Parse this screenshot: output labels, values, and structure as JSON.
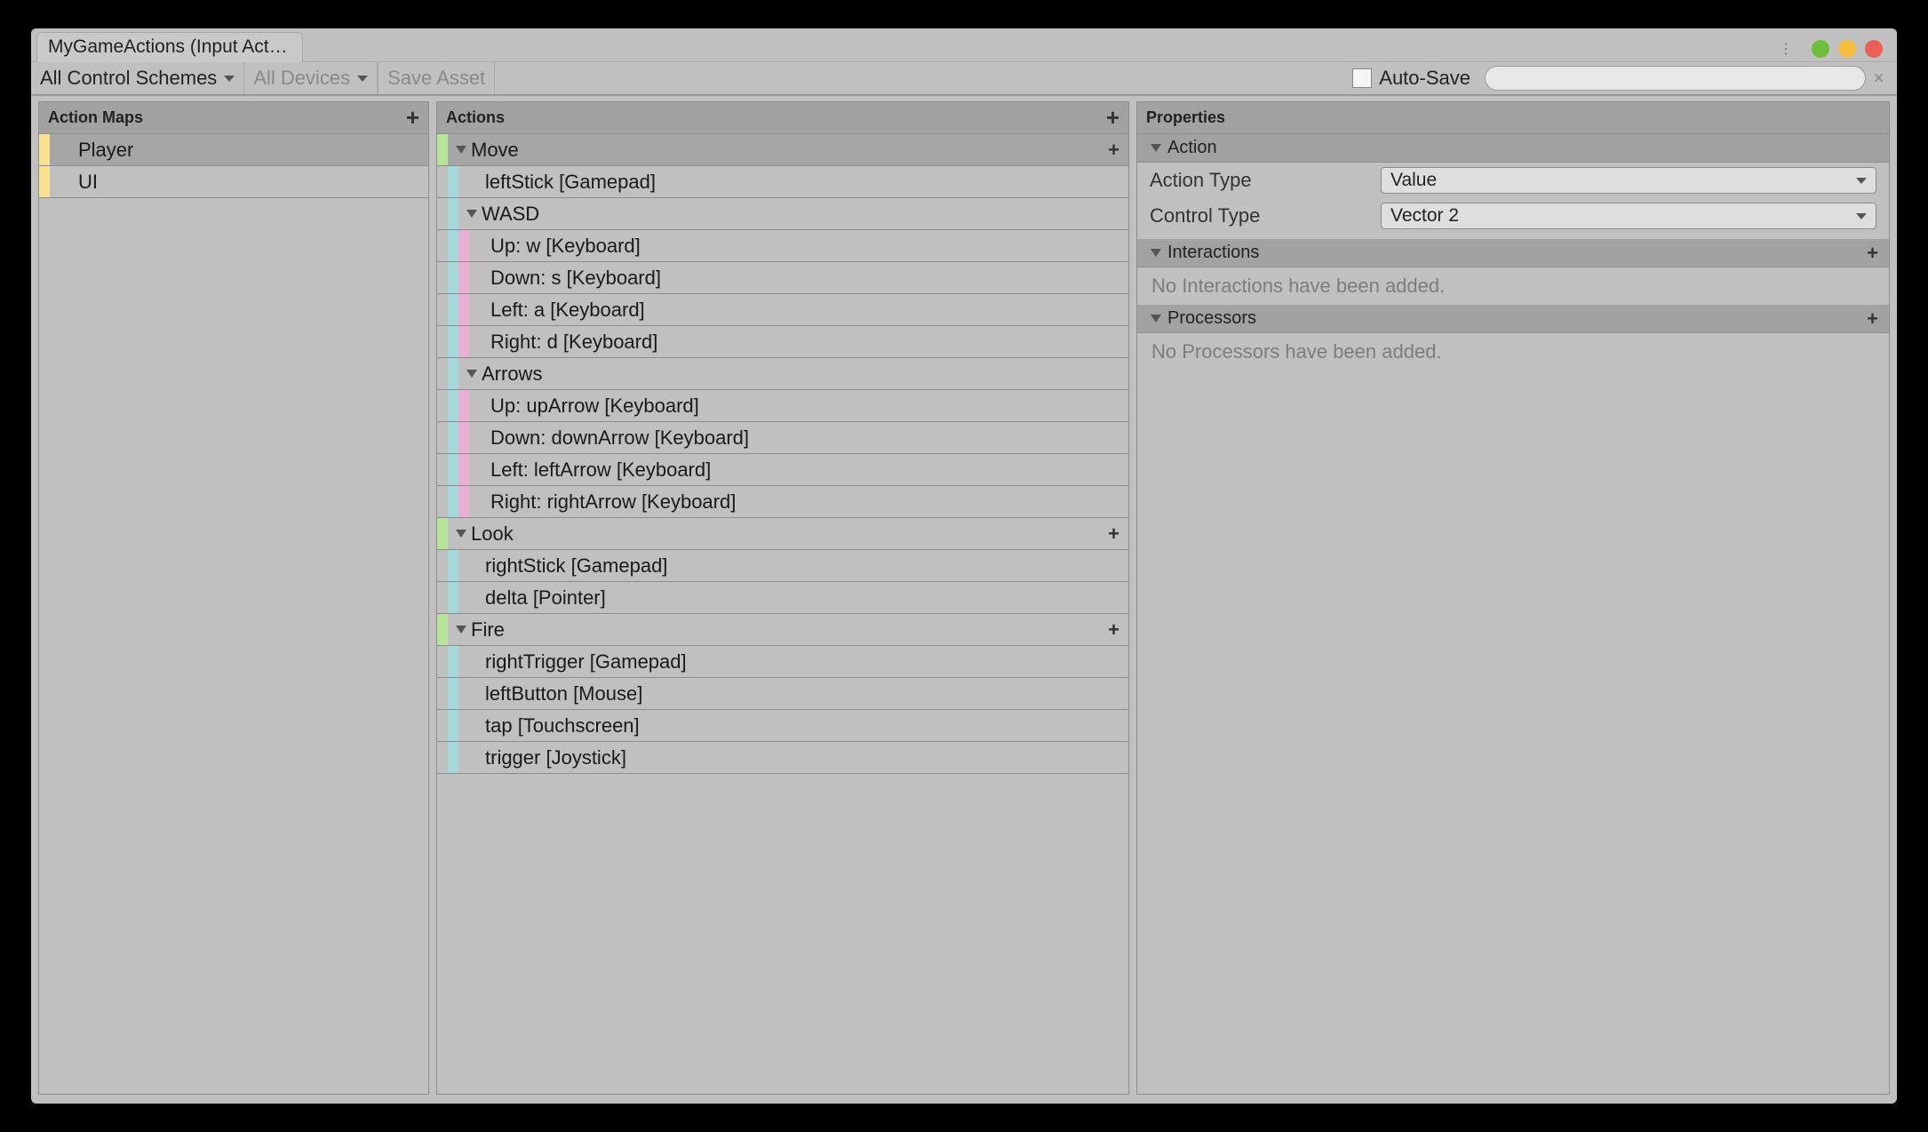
{
  "window": {
    "tab_title": "MyGameActions (Input Act…"
  },
  "toolbar": {
    "control_schemes": "All Control Schemes",
    "all_devices": "All Devices",
    "save_asset": "Save Asset",
    "auto_save": "Auto-Save"
  },
  "panels": {
    "action_maps_title": "Action Maps",
    "actions_title": "Actions",
    "properties_title": "Properties"
  },
  "action_maps": [
    {
      "name": "Player",
      "selected": true
    },
    {
      "name": "UI",
      "selected": false
    }
  ],
  "actions": [
    {
      "type": "action",
      "name": "Move",
      "selected": true,
      "color": "green",
      "expanded": true
    },
    {
      "type": "binding",
      "name": "leftStick [Gamepad]",
      "color": "teal",
      "indent": 1
    },
    {
      "type": "composite",
      "name": "WASD",
      "color": "teal",
      "expanded": true,
      "indent": 1
    },
    {
      "type": "binding",
      "name": "Up: w [Keyboard]",
      "color": "pink",
      "indent": 2
    },
    {
      "type": "binding",
      "name": "Down: s [Keyboard]",
      "color": "pink",
      "indent": 2
    },
    {
      "type": "binding",
      "name": "Left: a [Keyboard]",
      "color": "pink",
      "indent": 2
    },
    {
      "type": "binding",
      "name": "Right: d [Keyboard]",
      "color": "pink",
      "indent": 2
    },
    {
      "type": "composite",
      "name": "Arrows",
      "color": "teal",
      "expanded": true,
      "indent": 1
    },
    {
      "type": "binding",
      "name": "Up: upArrow [Keyboard]",
      "color": "pink",
      "indent": 2
    },
    {
      "type": "binding",
      "name": "Down: downArrow [Keyboard]",
      "color": "pink",
      "indent": 2
    },
    {
      "type": "binding",
      "name": "Left: leftArrow [Keyboard]",
      "color": "pink",
      "indent": 2
    },
    {
      "type": "binding",
      "name": "Right: rightArrow [Keyboard]",
      "color": "pink",
      "indent": 2
    },
    {
      "type": "action",
      "name": "Look",
      "color": "green",
      "expanded": true
    },
    {
      "type": "binding",
      "name": "rightStick [Gamepad]",
      "color": "teal",
      "indent": 1
    },
    {
      "type": "binding",
      "name": "delta [Pointer]",
      "color": "teal",
      "indent": 1
    },
    {
      "type": "action",
      "name": "Fire",
      "color": "green",
      "expanded": true
    },
    {
      "type": "binding",
      "name": "rightTrigger [Gamepad]",
      "color": "teal",
      "indent": 1
    },
    {
      "type": "binding",
      "name": "leftButton [Mouse]",
      "color": "teal",
      "indent": 1
    },
    {
      "type": "binding",
      "name": "tap [Touchscreen]",
      "color": "teal",
      "indent": 1
    },
    {
      "type": "binding",
      "name": "trigger [Joystick]",
      "color": "teal",
      "indent": 1
    }
  ],
  "properties": {
    "action_section": "Action",
    "action_type_label": "Action Type",
    "action_type_value": "Value",
    "control_type_label": "Control Type",
    "control_type_value": "Vector 2",
    "interactions_section": "Interactions",
    "interactions_empty": "No Interactions have been added.",
    "processors_section": "Processors",
    "processors_empty": "No Processors have been added."
  }
}
